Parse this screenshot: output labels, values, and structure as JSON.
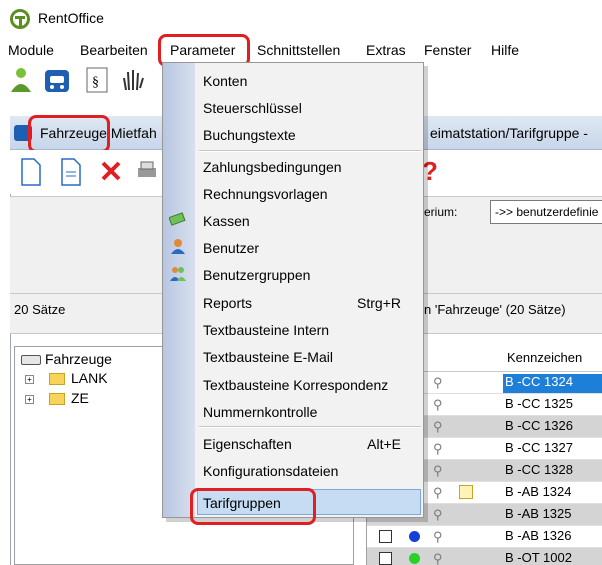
{
  "window": {
    "title": "RentOffice"
  },
  "menubar": {
    "items": [
      {
        "label": "Module"
      },
      {
        "label": "Bearbeiten"
      },
      {
        "label": "Parameter"
      },
      {
        "label": "Schnittstellen"
      },
      {
        "label": "Extras"
      },
      {
        "label": "Fenster"
      },
      {
        "label": "Hilfe"
      }
    ]
  },
  "subwindow": {
    "title_prefix": "Fahrzeuge",
    "title_mid": "Mietfah",
    "title_suffix": "eimatstation/Tarifgruppe -"
  },
  "filter": {
    "label": "erium:",
    "select_value": "->> benutzerdefinie"
  },
  "status": {
    "count": "20 Sätze",
    "right": "n 'Fahrzeuge' (20 Sätze)"
  },
  "tree": {
    "root": "Fahrzeuge",
    "children": [
      "LANK",
      "ZE"
    ]
  },
  "grid": {
    "header": "Kennzeichen",
    "rows": [
      {
        "plate": "B -CC 1324"
      },
      {
        "plate": "B -CC 1325"
      },
      {
        "plate": "B -CC 1326"
      },
      {
        "plate": "B -CC 1327"
      },
      {
        "plate": "B -CC 1328"
      },
      {
        "plate": "B -AB 1324"
      },
      {
        "plate": "B -AB 1325"
      },
      {
        "plate": "B -AB 1326"
      },
      {
        "plate": "B -OT 1002"
      }
    ]
  },
  "parameter_menu": {
    "items": [
      {
        "label": "Konten",
        "shortcut": ""
      },
      {
        "label": "Steuerschlüssel",
        "shortcut": ""
      },
      {
        "label": "Buchungstexte",
        "shortcut": ""
      },
      {
        "label": "Zahlungsbedingungen",
        "shortcut": ""
      },
      {
        "label": "Rechnungsvorlagen",
        "shortcut": ""
      },
      {
        "label": "Kassen",
        "shortcut": ""
      },
      {
        "label": "Benutzer",
        "shortcut": ""
      },
      {
        "label": "Benutzergruppen",
        "shortcut": ""
      },
      {
        "label": "Reports",
        "shortcut": "Strg+R"
      },
      {
        "label": "Textbausteine Intern",
        "shortcut": ""
      },
      {
        "label": "Textbausteine E-Mail",
        "shortcut": ""
      },
      {
        "label": "Textbausteine Korrespondenz",
        "shortcut": ""
      },
      {
        "label": "Nummernkontrolle",
        "shortcut": ""
      },
      {
        "label": "Eigenschaften",
        "shortcut": "Alt+E"
      },
      {
        "label": "Konfigurationsdateien",
        "shortcut": ""
      },
      {
        "label": "Tarifgruppen",
        "shortcut": ""
      }
    ]
  },
  "colors": {
    "highlight_box": "#e02020",
    "menu_highlight": "#c6dcf3",
    "selected_row": "#1e7fd8"
  }
}
